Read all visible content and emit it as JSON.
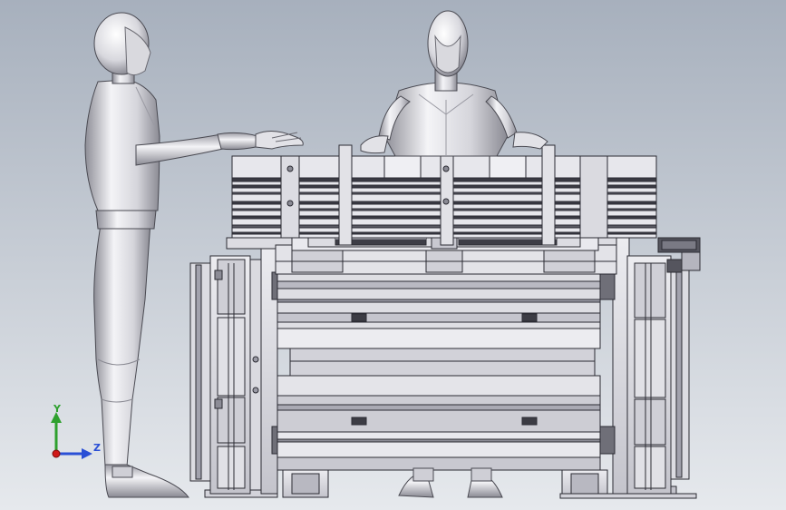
{
  "viewport": {
    "background_top": "#a7b0bd",
    "background_bottom": "#e6e9ed"
  },
  "palette": {
    "metal_light": "#e6e6eb",
    "metal_mid": "#c9c9d1",
    "metal_dark": "#8f8f9a",
    "edge": "#2b2b33",
    "mannequin_light": "#f1f1f4",
    "mannequin_shadow": "#9d9da6"
  },
  "triad": {
    "y_label": "Y",
    "z_label": "Z",
    "y_color": "#2ea02e",
    "z_color": "#2a4fd6",
    "x_color": "#d01818"
  },
  "figures": [
    {
      "id": "standing-mannequin",
      "icon": "person-standing-icon"
    },
    {
      "id": "seated-mannequin",
      "icon": "person-seated-icon"
    }
  ],
  "machine": {
    "icon": "machine-assembly-icon"
  }
}
